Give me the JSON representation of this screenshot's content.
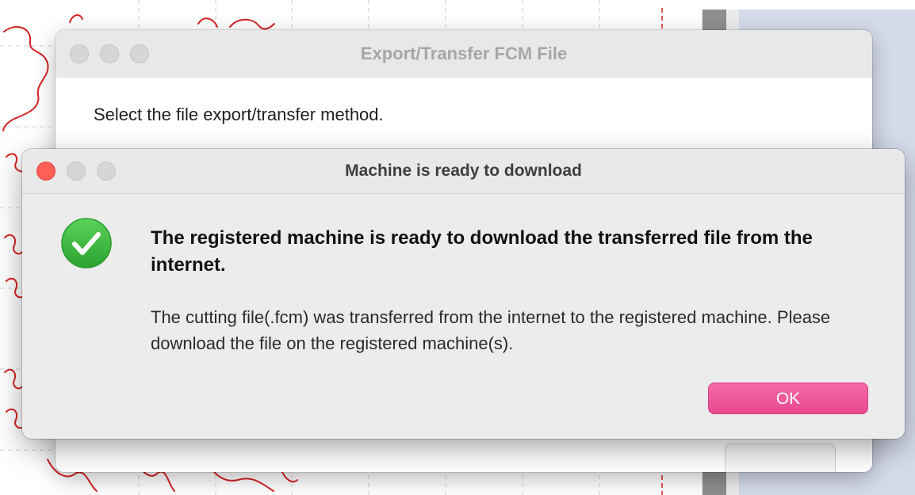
{
  "back_window": {
    "title": "Export/Transfer FCM File",
    "prompt": "Select the file export/transfer method."
  },
  "alert": {
    "title": "Machine is ready to download",
    "heading": "The registered machine is ready to download the transferred file from the internet.",
    "message": "The cutting file(.fcm) was transferred from the internet to the registered machine. Please download the file on the registered machine(s).",
    "ok_label": "OK",
    "icon": "checkmark-circle-icon"
  },
  "colors": {
    "accent_button": "#ec4f95",
    "success_green": "#3cb83f",
    "close_red": "#fe5f57",
    "canvas_path": "#d42323",
    "side_panel": "#d5dbeb"
  }
}
